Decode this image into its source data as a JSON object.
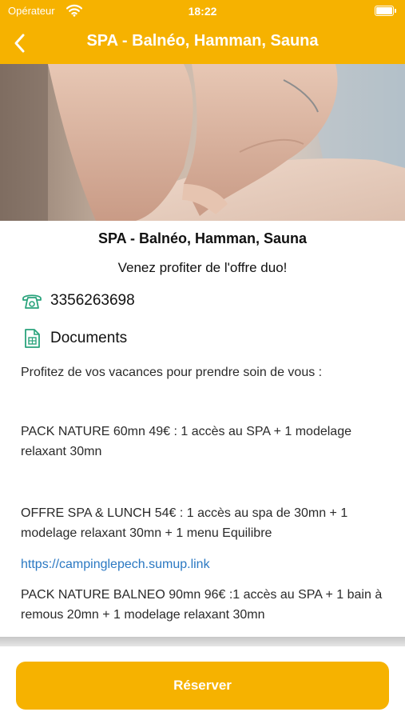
{
  "statusbar": {
    "carrier": "Opérateur",
    "time": "18:22"
  },
  "navbar": {
    "title": "SPA - Balnéo, Hamman, Sauna",
    "back_icon": "chevron-left-icon"
  },
  "colors": {
    "accent": "#f6b200",
    "link": "#2a78c2",
    "icon": "#2aa37c"
  },
  "hero": {
    "image": "massage-photo"
  },
  "detail": {
    "title": "SPA - Balnéo, Hamman, Sauna",
    "subtitle": "Venez profiter de l'offre duo!",
    "phone": {
      "icon": "phone-icon",
      "value": "3356263698"
    },
    "documents": {
      "icon": "document-icon",
      "label": "Documents"
    },
    "paragraphs": {
      "intro": "Profitez de vos vacances pour prendre soin de vous :",
      "nature": "PACK NATURE 60mn 49€ : 1 accès au SPA + 1 modelage relaxant 30mn",
      "lunch": "OFFRE SPA & LUNCH 54€ : 1 accès au spa de 30mn + 1 modelage relaxant 30mn + 1 menu Equilibre",
      "link": "https://campinglepech.sumup.link",
      "balneo": "PACK NATURE BALNEO 90mn 96€ :1 accès au SPA + 1 bain à remous 20mn + 1 modelage relaxant 30mn"
    }
  },
  "footer": {
    "reserve_label": "Réserver"
  }
}
